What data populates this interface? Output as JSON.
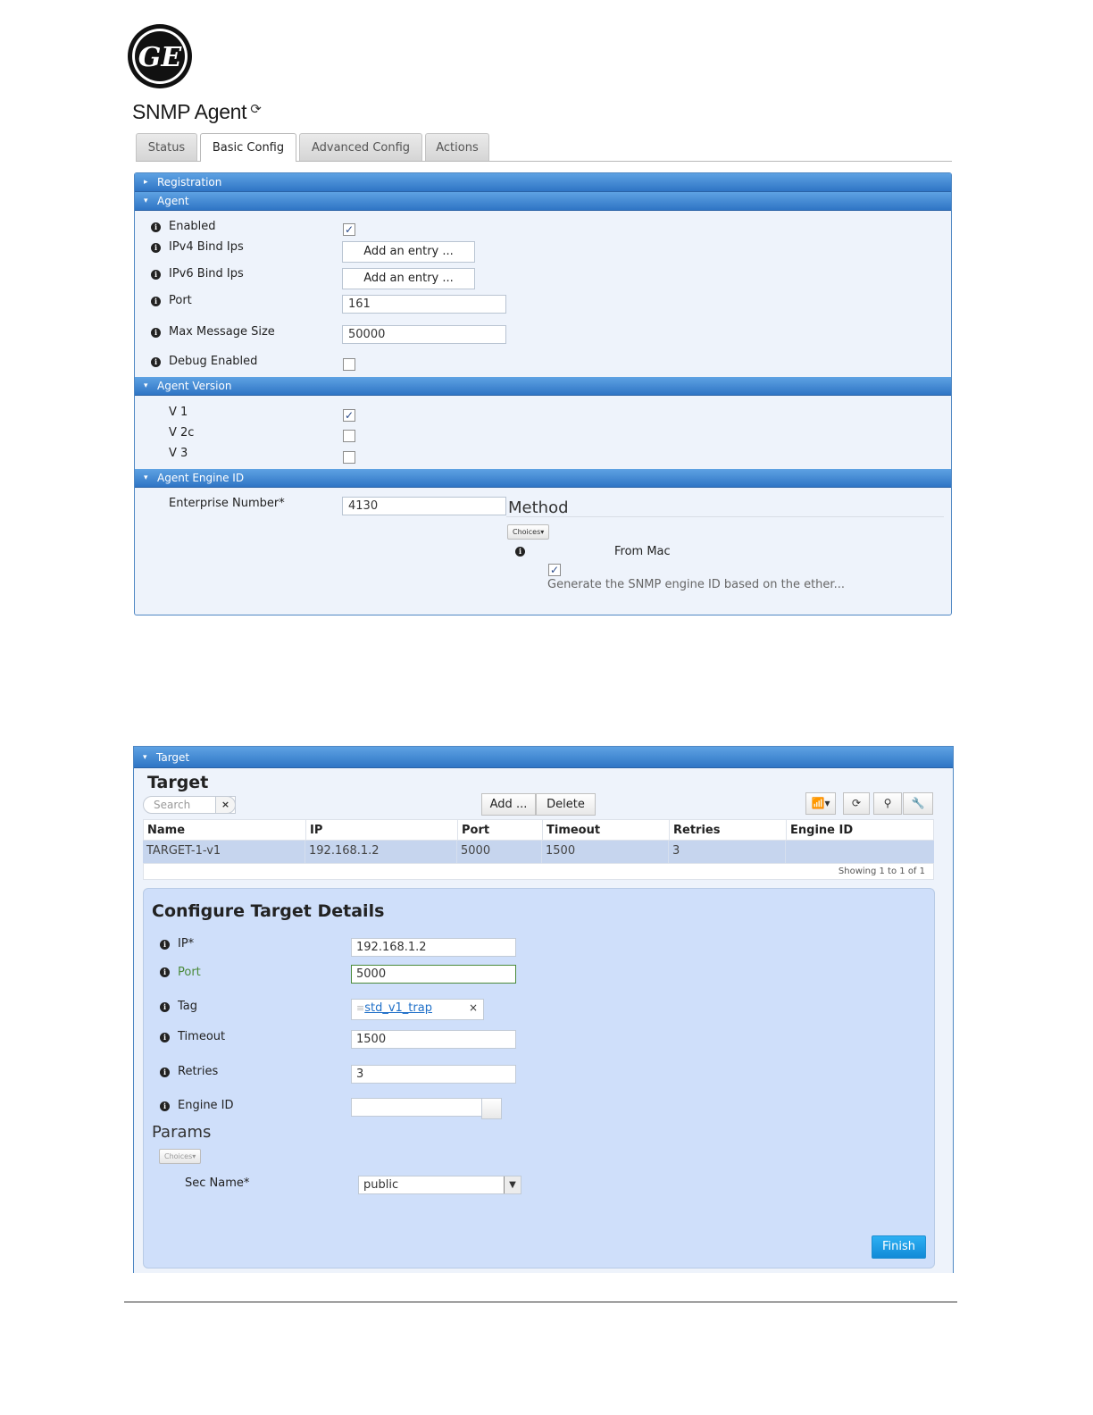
{
  "logo": {
    "text": "GE"
  },
  "page": {
    "title": "SNMP Agent",
    "refresh_icon": "refresh-icon"
  },
  "tabs": [
    {
      "label": "Status"
    },
    {
      "label": "Basic Config",
      "active": true
    },
    {
      "label": "Advanced Config"
    },
    {
      "label": "Actions"
    }
  ],
  "sections": {
    "registration": "Registration",
    "agent": "Agent",
    "agent_version": "Agent Version",
    "agent_engine_id": "Agent Engine ID"
  },
  "agent": {
    "enabled": {
      "label": "Enabled",
      "checked": true
    },
    "ipv4": {
      "label": "IPv4 Bind Ips",
      "button": "Add an entry ..."
    },
    "ipv6": {
      "label": "IPv6 Bind Ips",
      "button": "Add an entry ..."
    },
    "port": {
      "label": "Port",
      "value": "161"
    },
    "max_message": {
      "label": "Max Message Size",
      "value": "50000"
    },
    "debug": {
      "label": "Debug Enabled",
      "checked": false
    }
  },
  "agent_version": {
    "v1": {
      "label": "V 1",
      "checked": true
    },
    "v2c": {
      "label": "V 2c",
      "checked": false
    },
    "v3": {
      "label": "V 3",
      "checked": false
    }
  },
  "engine": {
    "enterprise_label": "Enterprise Number*",
    "enterprise_value": "4130",
    "method_title": "Method",
    "choices": "Choices▾",
    "from_mac": "From Mac",
    "from_mac_checked": true,
    "hint": "Generate the SNMP engine ID based on the ether..."
  },
  "target": {
    "bar": "Target",
    "title": "Target",
    "search_placeholder": "Search",
    "search_clear": "×",
    "add_button": "Add ...",
    "delete_button": "Delete",
    "tools": [
      "signal-icon",
      "refresh-icon",
      "search-icon",
      "wrench-icon"
    ],
    "columns": [
      "Name",
      "IP",
      "Port",
      "Timeout",
      "Retries",
      "Engine ID"
    ],
    "rows": [
      [
        "TARGET-1-v1",
        "192.168.1.2",
        "5000",
        "1500",
        "3",
        ""
      ]
    ],
    "footer": "Showing 1 to 1 of 1"
  },
  "details": {
    "title": "Configure Target Details",
    "ip": {
      "label": "IP*",
      "value": "192.168.1.2"
    },
    "port": {
      "label": "Port",
      "value": "5000"
    },
    "tag": {
      "label": "Tag",
      "value": "std_v1_trap",
      "remove": "×"
    },
    "timeout": {
      "label": "Timeout",
      "value": "1500"
    },
    "retries": {
      "label": "Retries",
      "value": "3"
    },
    "engine_id": {
      "label": "Engine ID",
      "value": ""
    },
    "params_title": "Params",
    "choices": "Choices▾",
    "sec_name": {
      "label": "Sec Name*",
      "value": "public"
    },
    "finish": "Finish"
  },
  "colors": {
    "section_bar": "#3a82cf",
    "panel_bg": "#eef3fb",
    "details_bg": "#cfdffa",
    "selected_row": "#c6d5ee",
    "port_valid": "#4a8a3a",
    "finish_button": "#1a96e0"
  }
}
